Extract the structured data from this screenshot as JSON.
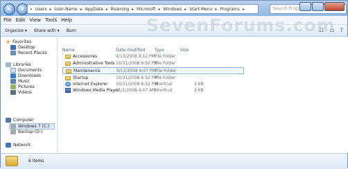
{
  "address": {
    "crumbs": [
      "Users",
      "User-Name",
      "AppData",
      "Roaming",
      "Microsoft",
      "Windows",
      "Start Menu",
      "Programs"
    ],
    "separator": "▸",
    "overflow": "«"
  },
  "search": {
    "placeholder": "Search Programs"
  },
  "menu": [
    "File",
    "Edit",
    "View",
    "Tools",
    "Help"
  ],
  "toolbar": {
    "organize": "Organize ▾",
    "share": "Share with ▾",
    "burn": "Burn"
  },
  "watermark": "SevenForums.com",
  "sidebar": {
    "favorites": {
      "label": "Favorites",
      "items": [
        "Desktop",
        "Recent Places"
      ]
    },
    "libraries": {
      "label": "Libraries",
      "items": [
        "Documents",
        "Downloads",
        "Music",
        "Pictures",
        "Videos"
      ]
    },
    "computer": {
      "label": "Computer",
      "items": [
        "Windows 7 (C:)",
        "Backup (D:)"
      ]
    },
    "network": {
      "label": "Network"
    }
  },
  "columns": {
    "name": "Name",
    "date": "Date modified",
    "type": "Type",
    "size": "Size"
  },
  "files": [
    {
      "name": "Accessories",
      "date": "9/13/2008 9:12 PM",
      "type": "File Folder",
      "size": "",
      "icon": "folder-icon"
    },
    {
      "name": "Administrative Tools",
      "date": "10/31/2008 6:52 PM",
      "type": "File Folder",
      "size": "",
      "icon": "folder-icon"
    },
    {
      "name": "Maintenance",
      "date": "9/13/2008 9:07 PM",
      "type": "File Folder",
      "size": "",
      "icon": "folder-icon"
    },
    {
      "name": "Startup",
      "date": "10/31/2008 6:52 PM",
      "type": "File Folder",
      "size": "",
      "icon": "folder-icon"
    },
    {
      "name": "Internet Explorer",
      "date": "10/31/2008 6:52 PM",
      "type": "Shortcut",
      "size": "2 KB",
      "icon": "internet-explorer-icon"
    },
    {
      "name": "Windows Media Player",
      "date": "11/1/2008 4:07 AM",
      "type": "Shortcut",
      "size": "2 KB",
      "icon": "windows-media-player-icon"
    }
  ],
  "status": {
    "count": "6 items"
  }
}
